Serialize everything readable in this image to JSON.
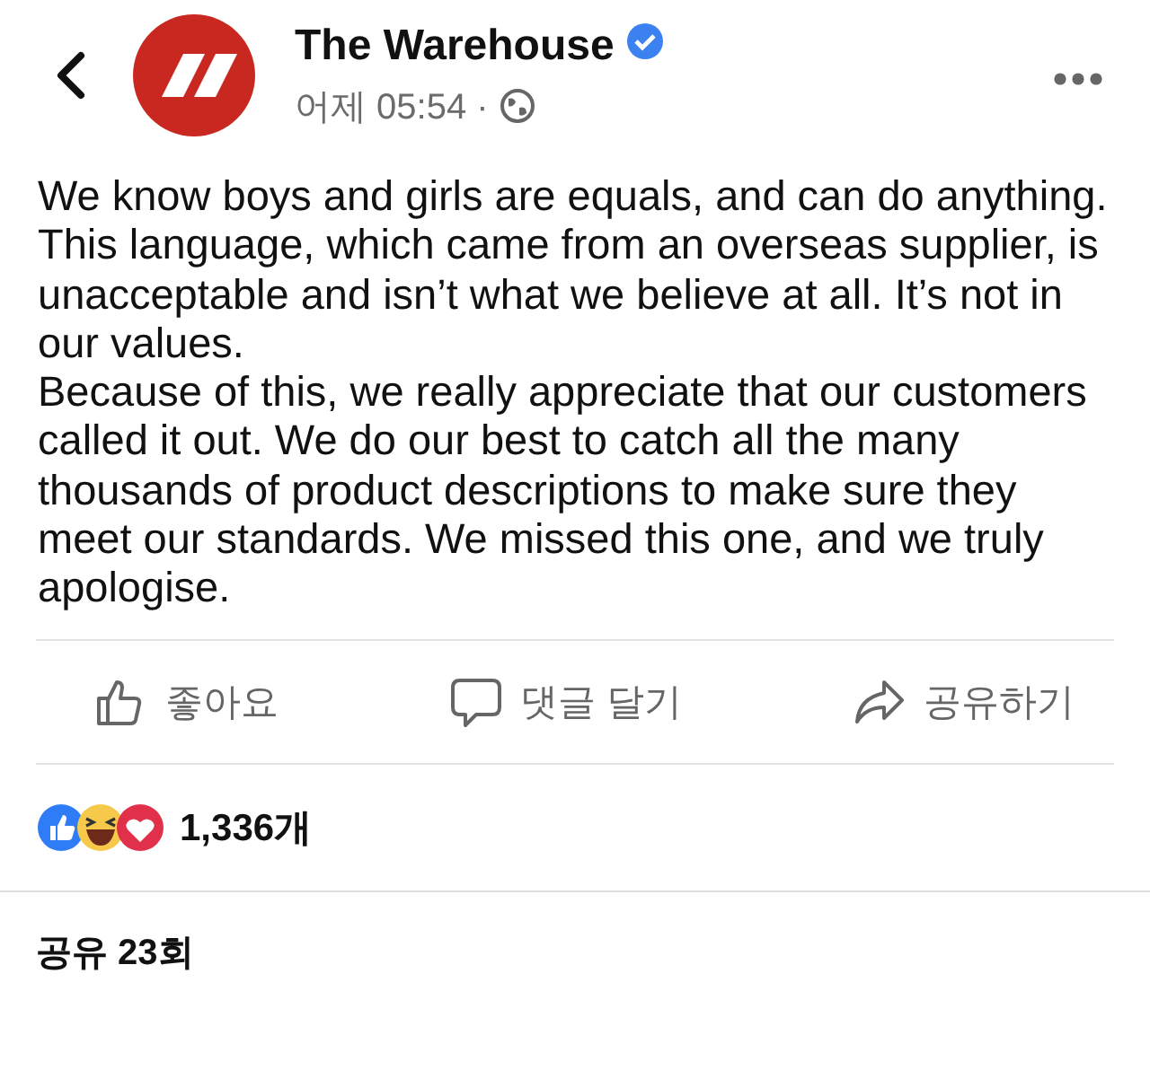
{
  "post": {
    "author": "The Warehouse",
    "verified": true,
    "time": "어제 05:54 ·",
    "paragraphs": [
      "We know boys and girls are equals, and can do anything. This language, which came from an overseas supplier, is unacceptable and isn’t what we believe at all. It’s not in our values.",
      "Because of this, we really appreciate that our customers called it out. We do our best to catch all the many thousands of product descriptions to make sure they meet our standards. We missed this one, and we truly apologise."
    ]
  },
  "actions": [
    {
      "kind": "like",
      "label": "좋아요"
    },
    {
      "kind": "comment",
      "label": "댓글 달기"
    },
    {
      "kind": "share",
      "label": "공유하기"
    }
  ],
  "reactions": {
    "count": "1,336개"
  },
  "shares": "공유 23회"
}
